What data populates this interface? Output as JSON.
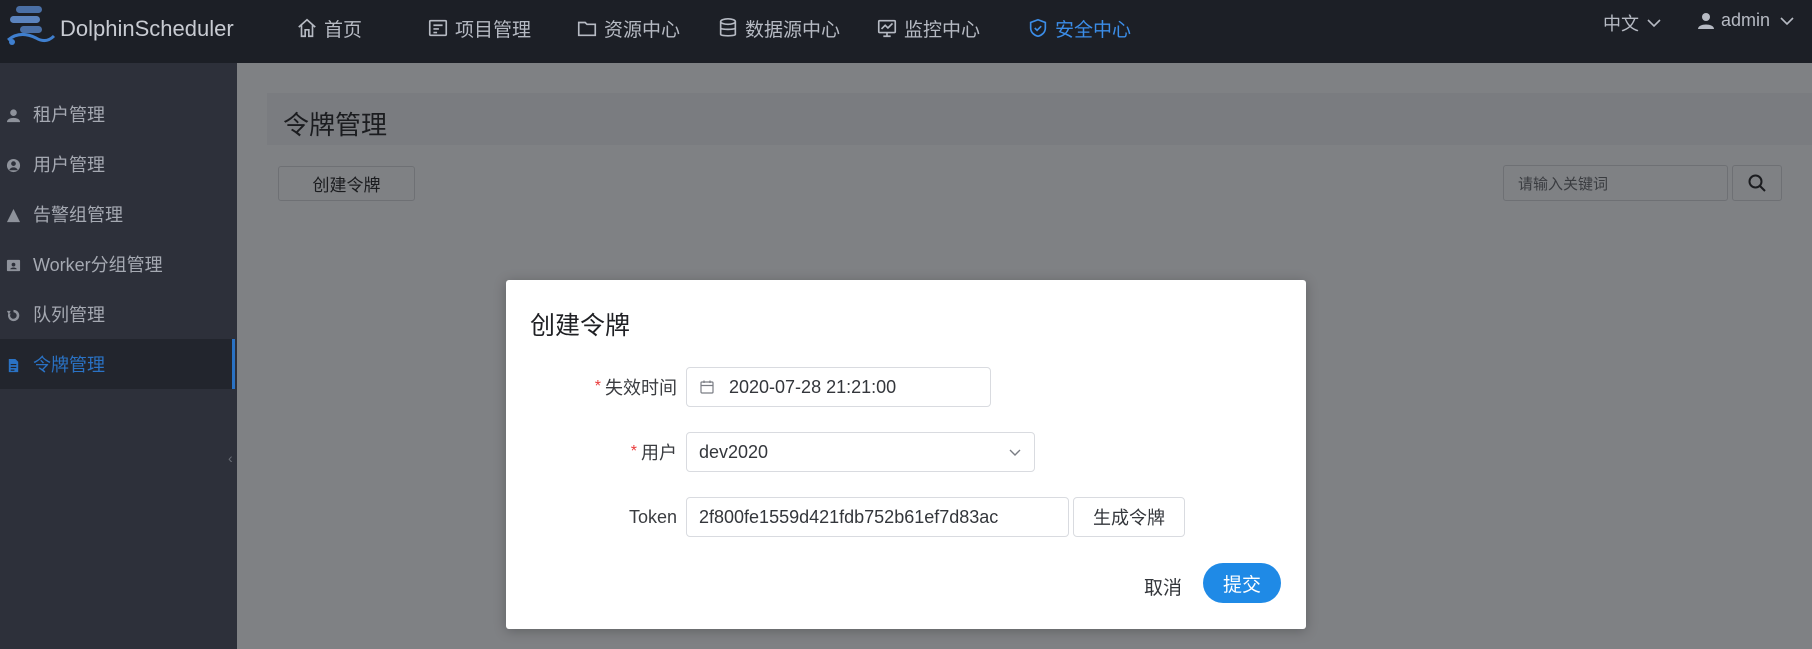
{
  "app": {
    "brand": "DolphinScheduler"
  },
  "topnav": {
    "items": [
      {
        "label": "首页",
        "icon": "home-icon"
      },
      {
        "label": "项目管理",
        "icon": "project-icon"
      },
      {
        "label": "资源中心",
        "icon": "folder-icon"
      },
      {
        "label": "数据源中心",
        "icon": "database-icon"
      },
      {
        "label": "监控中心",
        "icon": "monitor-icon"
      },
      {
        "label": "安全中心",
        "icon": "shield-icon",
        "active": true
      }
    ],
    "language": "中文",
    "user": "admin"
  },
  "sidebar": {
    "items": [
      {
        "label": "租户管理",
        "icon": "person-icon"
      },
      {
        "label": "用户管理",
        "icon": "user-circle-icon"
      },
      {
        "label": "告警组管理",
        "icon": "warning-icon"
      },
      {
        "label": "Worker分组管理",
        "icon": "id-card-icon"
      },
      {
        "label": "队列管理",
        "icon": "recycle-icon"
      },
      {
        "label": "令牌管理",
        "icon": "document-icon",
        "active": true
      }
    ],
    "collapse_glyph": "‹"
  },
  "main": {
    "title": "令牌管理",
    "create_button": "创建令牌",
    "search_placeholder": "请输入关键词"
  },
  "modal": {
    "title": "创建令牌",
    "required_mark": "*",
    "expire_label": "失效时间",
    "expire_value": "2020-07-28 21:21:00",
    "user_label": "用户",
    "user_value": "dev2020",
    "token_label": "Token",
    "token_value": "2f800fe1559d421fdb752b61ef7d83ac",
    "generate_button": "生成令牌",
    "cancel_button": "取消",
    "submit_button": "提交"
  },
  "colors": {
    "topbar": "#1c1f26",
    "sidebar": "#2d303a",
    "accent": "#1f8ae6",
    "active_nav": "#3b8de8",
    "required": "#ea3a3a"
  }
}
